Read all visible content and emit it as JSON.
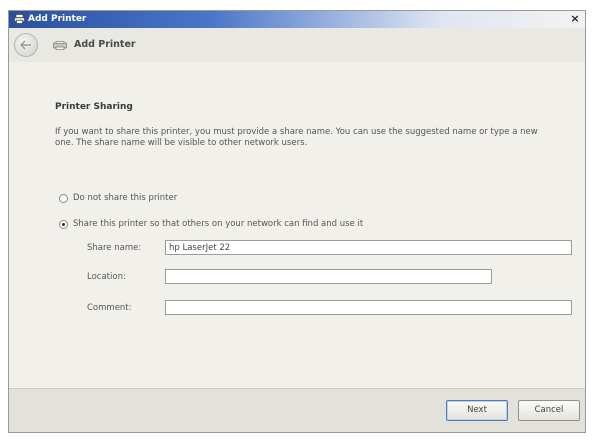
{
  "window": {
    "title": "Add Printer",
    "close_glyph": "×"
  },
  "nav": {
    "title": "Add Printer"
  },
  "page": {
    "heading": "Printer Sharing",
    "description": "If you want to share this printer, you must provide a share name. You can use the suggested name or type a new one. The share name will be visible to other network users."
  },
  "options": [
    {
      "label": "Do not share this printer",
      "checked": false
    },
    {
      "label": "Share this printer so that others on your network can find and use it",
      "checked": true
    }
  ],
  "fields": {
    "share_name": {
      "label": "Share name:",
      "value": "hp LaserJet 22"
    },
    "location": {
      "label": "Location:",
      "value": ""
    },
    "comment": {
      "label": "Comment:",
      "value": ""
    }
  },
  "buttons": {
    "next": "Next",
    "cancel": "Cancel"
  },
  "icons": {
    "title": "printer-icon",
    "back": "back-arrow-icon",
    "nav": "printer-icon",
    "close": "close-icon"
  }
}
